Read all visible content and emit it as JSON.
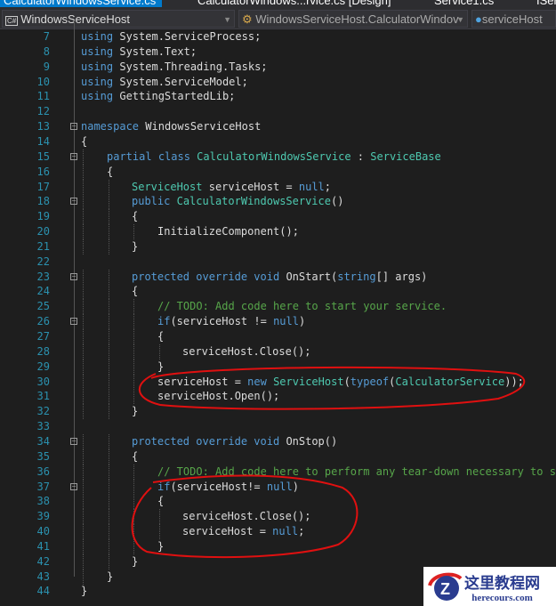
{
  "tabs": [
    {
      "label": "CalculatorWindowsService.cs",
      "active": true
    },
    {
      "label": "CalculatorWindows...rvice.cs [Design]"
    },
    {
      "label": "Service1.cs"
    },
    {
      "label": "ISer"
    }
  ],
  "nav": {
    "project": "WindowsServiceHost",
    "class": "WindowsServiceHost.CalculatorWindov",
    "member": "serviceHost"
  },
  "lines": [
    {
      "n": "7",
      "t": [
        [
          "k",
          "using"
        ],
        [
          "",
          "System.ServiceProcess;"
        ]
      ],
      "i": 0
    },
    {
      "n": "8",
      "t": [
        [
          "k",
          "using"
        ],
        [
          "",
          "System.Text;"
        ]
      ],
      "i": 0
    },
    {
      "n": "9",
      "t": [
        [
          "k",
          "using"
        ],
        [
          "",
          "System.Threading.Tasks;"
        ]
      ],
      "i": 0
    },
    {
      "n": "10",
      "t": [
        [
          "k",
          "using"
        ],
        [
          "",
          "System.ServiceModel;"
        ]
      ],
      "i": 0
    },
    {
      "n": "11",
      "t": [
        [
          "k",
          "using"
        ],
        [
          "",
          "GettingStartedLib;"
        ]
      ],
      "i": 0
    },
    {
      "n": "12",
      "t": [],
      "i": 0
    },
    {
      "n": "13",
      "t": [
        [
          "k",
          "namespace"
        ],
        [
          "",
          "WindowsServiceHost"
        ]
      ],
      "i": 0,
      "fold": true
    },
    {
      "n": "14",
      "t": [
        [
          "",
          "{"
        ]
      ],
      "i": 0
    },
    {
      "n": "15",
      "t": [
        [
          "k",
          "partial"
        ],
        [
          "k",
          "class"
        ],
        [
          "t",
          "CalculatorWindowsService"
        ],
        [
          "",
          ":"
        ],
        [
          "t",
          "ServiceBase"
        ]
      ],
      "i": 1,
      "fold": true
    },
    {
      "n": "16",
      "t": [
        [
          "",
          "{"
        ]
      ],
      "i": 1
    },
    {
      "n": "17",
      "t": [
        [
          "t",
          "ServiceHost"
        ],
        [
          "",
          "serviceHost ="
        ],
        [
          "k",
          "null"
        ],
        [
          "",
          ";"
        ]
      ],
      "i": 2
    },
    {
      "n": "18",
      "t": [
        [
          "k",
          "public"
        ],
        [
          "t",
          "CalculatorWindowsService"
        ],
        [
          "",
          "()"
        ]
      ],
      "i": 2,
      "fold": true
    },
    {
      "n": "19",
      "t": [
        [
          "",
          "{"
        ]
      ],
      "i": 2
    },
    {
      "n": "20",
      "t": [
        [
          "",
          "InitializeComponent();"
        ]
      ],
      "i": 3
    },
    {
      "n": "21",
      "t": [
        [
          "",
          "}"
        ]
      ],
      "i": 2
    },
    {
      "n": "22",
      "t": [],
      "i": 0
    },
    {
      "n": "23",
      "t": [
        [
          "k",
          "protected"
        ],
        [
          "k",
          "override"
        ],
        [
          "k",
          "void"
        ],
        [
          "",
          "OnStart("
        ],
        [
          "k",
          "string"
        ],
        [
          "",
          "[] args)"
        ]
      ],
      "i": 2,
      "fold": true
    },
    {
      "n": "24",
      "t": [
        [
          "",
          "{"
        ]
      ],
      "i": 2
    },
    {
      "n": "25",
      "t": [
        [
          "c",
          "// TODO: Add code here to start your service."
        ]
      ],
      "i": 3
    },
    {
      "n": "26",
      "t": [
        [
          "k",
          "if"
        ],
        [
          "",
          "(serviceHost !="
        ],
        [
          "k",
          "null"
        ],
        [
          "",
          ")"
        ]
      ],
      "i": 3,
      "fold": true
    },
    {
      "n": "27",
      "t": [
        [
          "",
          "{"
        ]
      ],
      "i": 3
    },
    {
      "n": "28",
      "t": [
        [
          "",
          "serviceHost.Close();"
        ]
      ],
      "i": 4
    },
    {
      "n": "29",
      "t": [
        [
          "",
          "}"
        ]
      ],
      "i": 3
    },
    {
      "n": "30",
      "t": [
        [
          "",
          "serviceHost ="
        ],
        [
          "k",
          "new"
        ],
        [
          "t",
          "ServiceHost"
        ],
        [
          "",
          "("
        ],
        [
          "k",
          "typeof"
        ],
        [
          "",
          "("
        ],
        [
          "t",
          "CalculatorService"
        ],
        [
          "",
          "));"
        ]
      ],
      "i": 3
    },
    {
      "n": "31",
      "t": [
        [
          "",
          "serviceHost.Open();"
        ]
      ],
      "i": 3
    },
    {
      "n": "32",
      "t": [
        [
          "",
          "}"
        ]
      ],
      "i": 2
    },
    {
      "n": "33",
      "t": [],
      "i": 0
    },
    {
      "n": "34",
      "t": [
        [
          "k",
          "protected"
        ],
        [
          "k",
          "override"
        ],
        [
          "k",
          "void"
        ],
        [
          "",
          "OnStop()"
        ]
      ],
      "i": 2,
      "fold": true
    },
    {
      "n": "35",
      "t": [
        [
          "",
          "{"
        ]
      ],
      "i": 2
    },
    {
      "n": "36",
      "t": [
        [
          "c",
          "// TODO: Add code here to perform any tear-down necessary to sto"
        ]
      ],
      "i": 3
    },
    {
      "n": "37",
      "t": [
        [
          "k",
          "if"
        ],
        [
          "",
          "(serviceHost!="
        ],
        [
          "k",
          "null"
        ],
        [
          "",
          ")"
        ]
      ],
      "i": 3,
      "fold": true
    },
    {
      "n": "38",
      "t": [
        [
          "",
          "{"
        ]
      ],
      "i": 3
    },
    {
      "n": "39",
      "t": [
        [
          "",
          "serviceHost.Close();"
        ]
      ],
      "i": 4
    },
    {
      "n": "40",
      "t": [
        [
          "",
          "serviceHost ="
        ],
        [
          "k",
          "null"
        ],
        [
          "",
          ";"
        ]
      ],
      "i": 4
    },
    {
      "n": "41",
      "t": [
        [
          "",
          "}"
        ]
      ],
      "i": 3
    },
    {
      "n": "42",
      "t": [
        [
          "",
          "}"
        ]
      ],
      "i": 2
    },
    {
      "n": "43",
      "t": [
        [
          "",
          "}"
        ]
      ],
      "i": 1
    },
    {
      "n": "44",
      "t": [
        [
          "",
          "}"
        ]
      ],
      "i": 0
    }
  ],
  "watermark": {
    "title": "这里教程网",
    "site": "herecours.com"
  },
  "colors": {
    "keyword": "#569cd6",
    "type": "#4ec9b0",
    "comment": "#57a64a",
    "annotation": "#e01010"
  }
}
